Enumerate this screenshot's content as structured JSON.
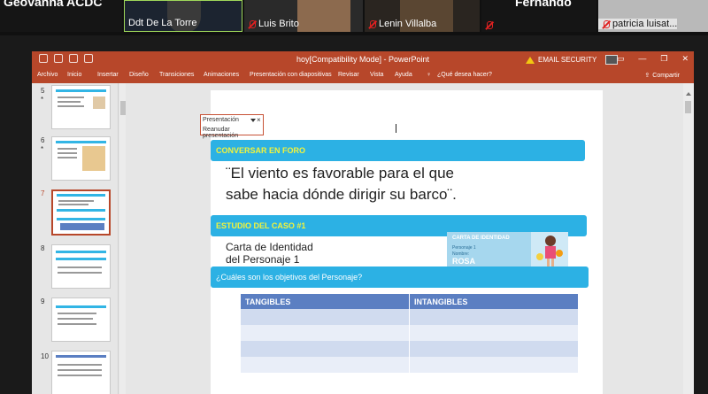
{
  "meeting": {
    "participants": [
      {
        "name": "Geovanna ACDC"
      },
      {
        "name": "Ddt De La Torre"
      },
      {
        "name": "Luis Brito"
      },
      {
        "name": "Lenin Villalba"
      },
      {
        "name": "Fernando"
      },
      {
        "name": "patricia luisat..."
      }
    ]
  },
  "window": {
    "doc_title": "hoy[Compatibility Mode] - PowerPoint",
    "security_label": "EMAIL SECURITY"
  },
  "menu": {
    "items": [
      "Archivo",
      "Inicio",
      "Insertar",
      "Diseño",
      "Transiciones",
      "Animaciones",
      "Presentación con diapositivas",
      "Revisar",
      "Vista",
      "Ayuda"
    ],
    "search": "¿Qué desea hacer?",
    "share": "Compartir"
  },
  "thumbnails": {
    "numbers": [
      "5",
      "6",
      "7",
      "8",
      "9",
      "10"
    ],
    "star": "*",
    "selected_index": 2
  },
  "popup": {
    "title": "Presentación",
    "action": "Reanudar presentación",
    "close": "×"
  },
  "slide": {
    "band1": "CONVERSAR EN FORO",
    "quote_line1": "¨El viento es favorable para el que",
    "quote_line2": "sabe hacia dónde dirigir su barco¨.",
    "band2": "ESTUDIO DEL CASO #1",
    "carta_line1": "Carta de Identidad",
    "carta_line2": "del Personaje 1",
    "card_title": "CARTA DE IDENTIDAD",
    "card_sub": "Personaje 1",
    "card_label": "Nombre:",
    "card_name": "ROSA",
    "band3": "¿Cuáles son los objetivos del Personaje?",
    "table_headers": [
      "TANGIBLES",
      "INTANGIBLES"
    ]
  },
  "colors": {
    "ppt_accent": "#b7472a",
    "band_blue": "#2cb1e4",
    "band_text_yellow": "#f3f33a",
    "table_header": "#5b7fc2",
    "muted_mic": "#e02020"
  }
}
